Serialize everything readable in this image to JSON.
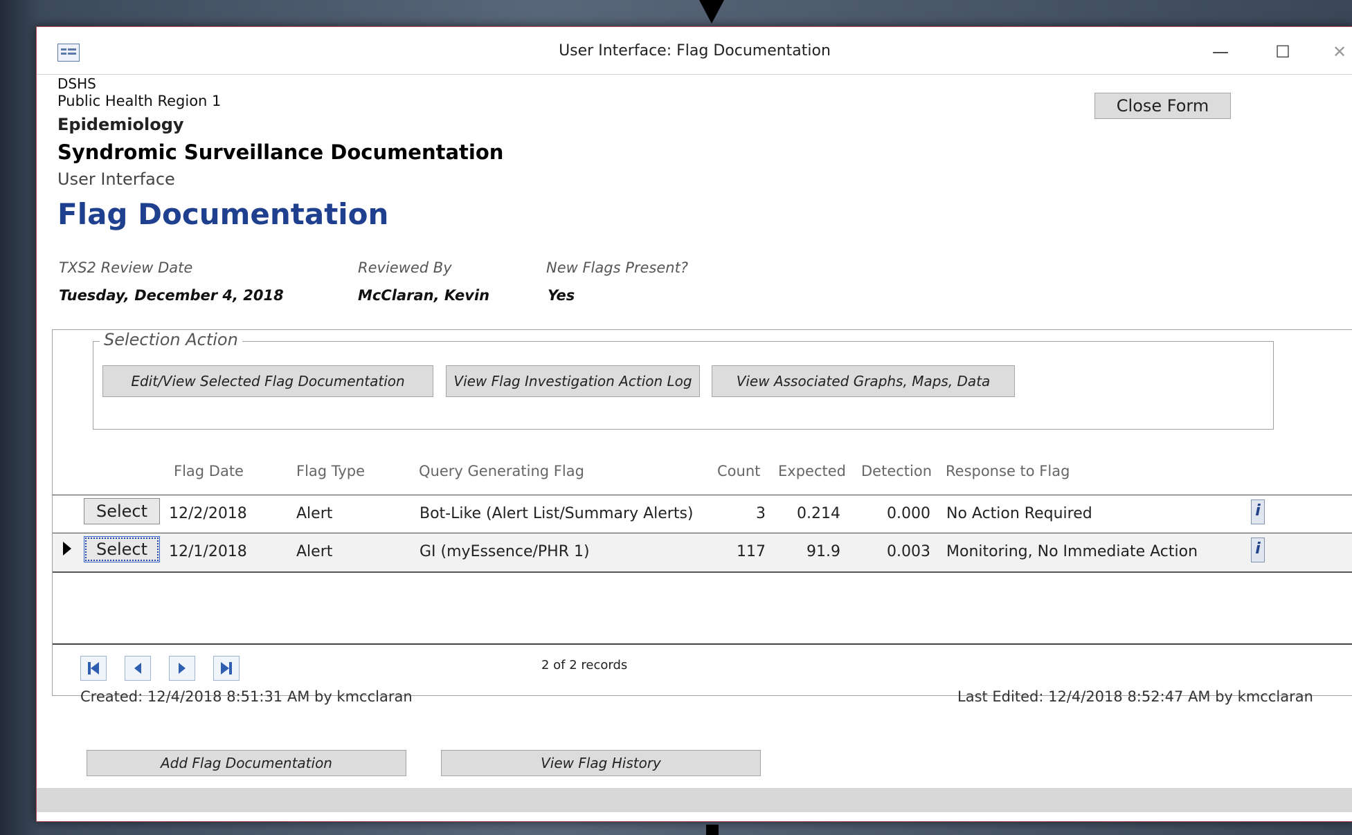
{
  "window": {
    "title": "User Interface: Flag Documentation",
    "minimize": "—",
    "maximize": "☐",
    "close": "✕"
  },
  "header": {
    "org": "DSHS",
    "region": "Public Health Region 1",
    "dept": "Epidemiology",
    "system": "Syndromic Surveillance Documentation",
    "subtitle": "User Interface",
    "page_title": "Flag Documentation",
    "close_form": "Close Form"
  },
  "review": {
    "date_label": "TXS2 Review Date",
    "date_value": "Tuesday, December 4, 2018",
    "reviewer_label": "Reviewed By",
    "reviewer_value": "McClaran, Kevin",
    "new_flags_label": "New Flags Present?",
    "new_flags_value": "Yes"
  },
  "selection_action": {
    "legend": "Selection Action",
    "buttons": [
      "Edit/View Selected Flag Documentation",
      "View Flag Investigation Action Log",
      "View Associated Graphs, Maps, Data"
    ]
  },
  "table": {
    "columns": [
      "Flag Date",
      "Flag Type",
      "Query Generating Flag",
      "Count",
      "Expected",
      "Detection",
      "Response to Flag"
    ],
    "rows": [
      {
        "select": "Select",
        "flag_date": "12/2/2018",
        "flag_type": "Alert",
        "query": "Bot-Like (Alert List/Summary Alerts)",
        "count": "3",
        "expected": "0.214",
        "detection": "0.000",
        "response": "No Action Required",
        "info": "i"
      },
      {
        "select": "Select",
        "flag_date": "12/1/2018",
        "flag_type": "Alert",
        "query": "GI (myEssence/PHR 1)",
        "count": "117",
        "expected": "91.9",
        "detection": "0.003",
        "response": "Monitoring, No Immediate Action",
        "info": "i"
      }
    ]
  },
  "navigation": {
    "records": "2 of 2 records"
  },
  "meta": {
    "created": "Created: 12/4/2018 8:51:31 AM by kmcclaran",
    "edited": "Last Edited: 12/4/2018 8:52:47 AM by kmcclaran"
  },
  "footer": {
    "add": "Add Flag Documentation",
    "history": "View Flag History"
  }
}
